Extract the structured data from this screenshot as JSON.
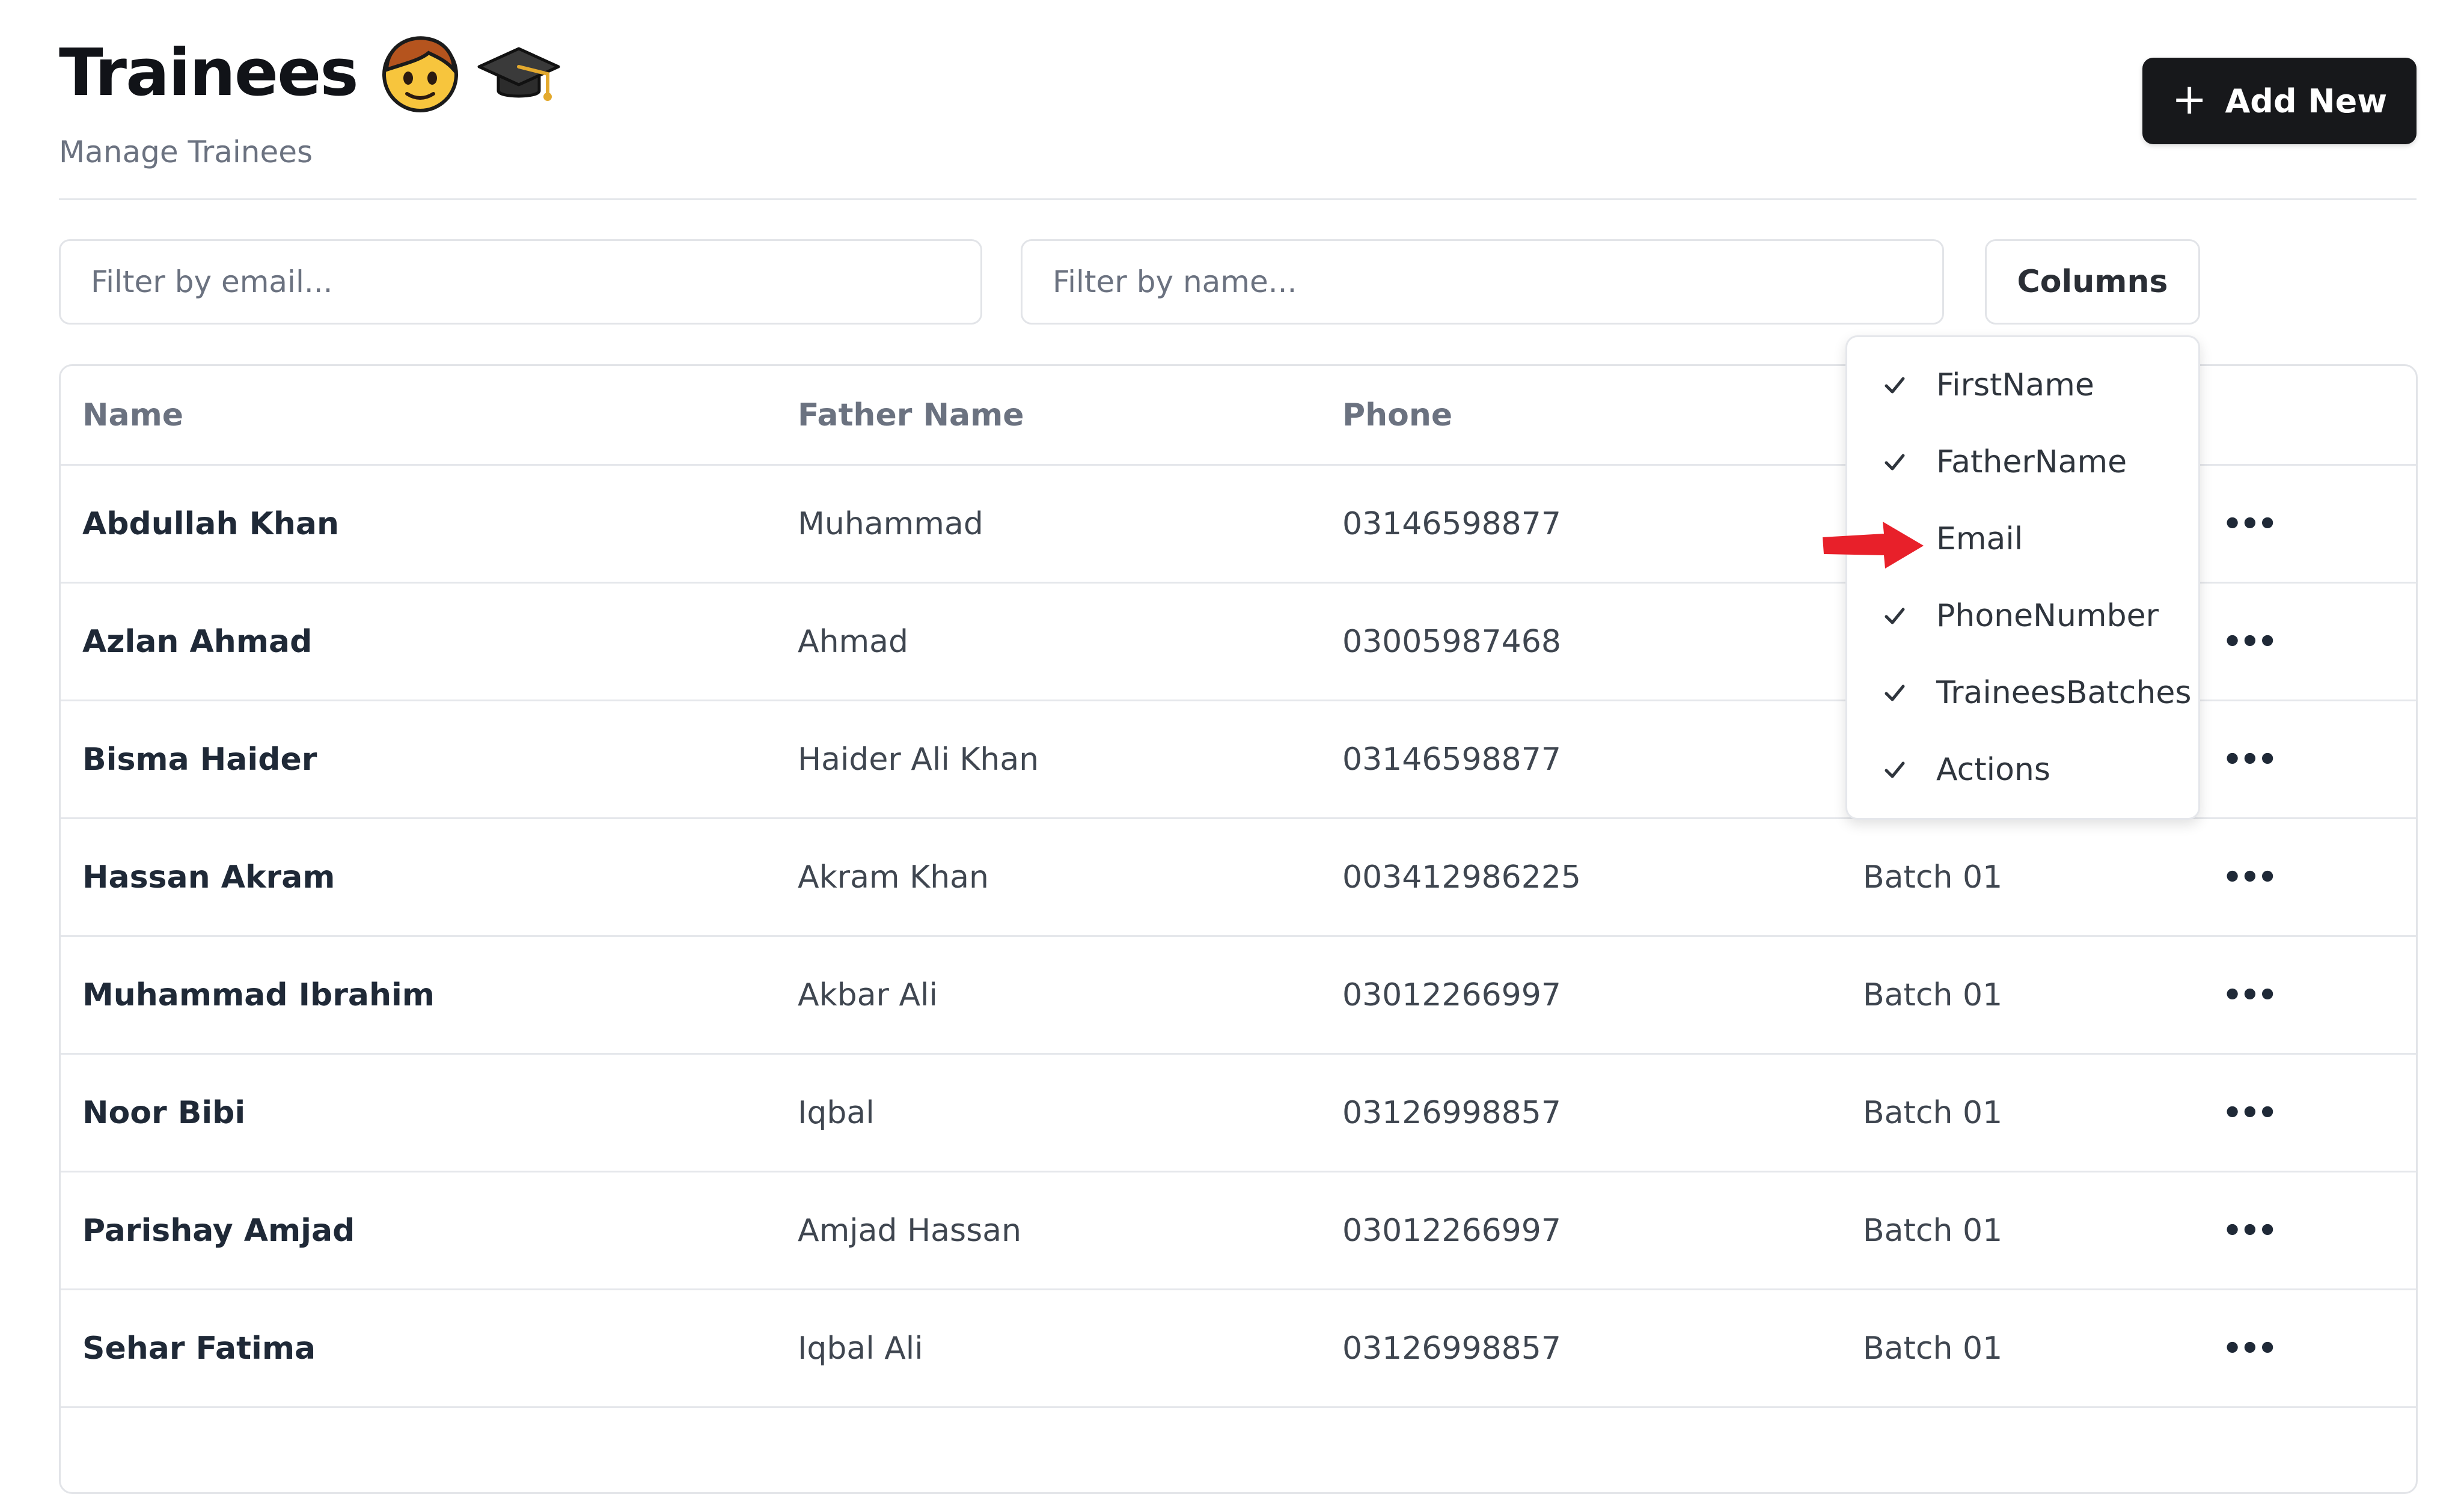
{
  "header": {
    "title": "Trainees",
    "subtitle": "Manage Trainees",
    "add_button_label": "Add New"
  },
  "filters": {
    "email_placeholder": "Filter by email...",
    "name_placeholder": "Filter by name...",
    "columns_button_label": "Columns"
  },
  "table": {
    "headers": {
      "name": "Name",
      "father_name": "Father Name",
      "phone": "Phone"
    },
    "rows": [
      {
        "name": "Abdullah Khan",
        "father_name": "Muhammad",
        "phone": "03146598877",
        "batch": ""
      },
      {
        "name": "Azlan Ahmad",
        "father_name": "Ahmad",
        "phone": "03005987468",
        "batch": ""
      },
      {
        "name": "Bisma Haider",
        "father_name": "Haider Ali Khan",
        "phone": "03146598877",
        "batch": ""
      },
      {
        "name": "Hassan Akram",
        "father_name": "Akram Khan",
        "phone": "003412986225",
        "batch": "Batch 01"
      },
      {
        "name": "Muhammad Ibrahim",
        "father_name": "Akbar Ali",
        "phone": "03012266997",
        "batch": "Batch 01"
      },
      {
        "name": "Noor Bibi",
        "father_name": "Iqbal",
        "phone": "03126998857",
        "batch": "Batch 01"
      },
      {
        "name": "Parishay Amjad",
        "father_name": "Amjad Hassan",
        "phone": "03012266997",
        "batch": "Batch 01"
      },
      {
        "name": "Sehar Fatima",
        "father_name": "Iqbal Ali",
        "phone": "03126998857",
        "batch": "Batch 01"
      }
    ]
  },
  "columns_menu": {
    "items": [
      {
        "label": "FirstName",
        "checked": true
      },
      {
        "label": "FatherName",
        "checked": true
      },
      {
        "label": "Email",
        "checked": false
      },
      {
        "label": "PhoneNumber",
        "checked": true
      },
      {
        "label": "TraineesBatches",
        "checked": true
      },
      {
        "label": "Actions",
        "checked": true
      }
    ]
  },
  "icons": {
    "title_emoji_1": "boy-face-icon",
    "title_emoji_2": "graduation-cap-icon",
    "add_icon": "plus-icon",
    "row_actions_icon": "ellipsis-icon",
    "check_icon": "checkmark-icon",
    "annotation": "red-arrow-icon"
  },
  "colors": {
    "primary_button": "#17181b",
    "annotation_arrow": "#e8202a",
    "border": "#e2e4e8",
    "muted_text": "#6b7280"
  }
}
